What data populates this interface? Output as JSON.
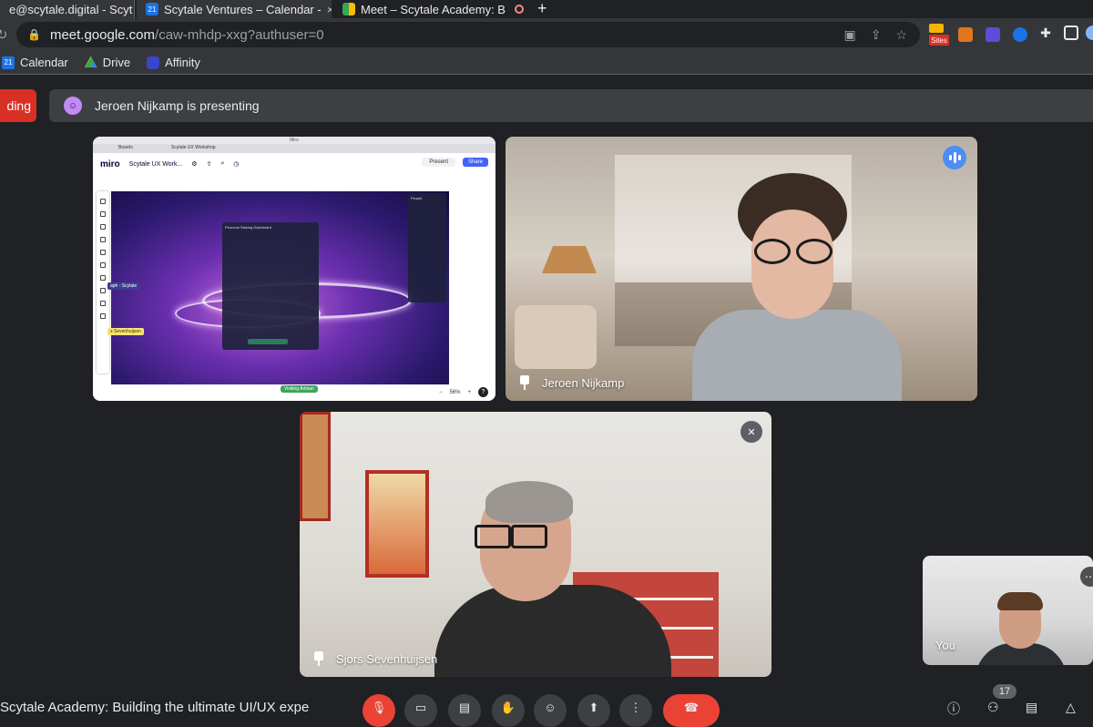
{
  "browser": {
    "tabs": [
      {
        "title": "e@scytale.digital - Scyt",
        "favicon": "gmail-icon"
      },
      {
        "title": "Scytale Ventures – Calendar - ",
        "favicon": "calendar-icon"
      },
      {
        "title": "Meet – Scytale Academy: B",
        "favicon": "meet-icon",
        "recording": true,
        "active": true
      }
    ],
    "new_tab": "+",
    "url_host": "meet.google.com",
    "url_path": "/caw-mhdp-xxg?authuser=0",
    "sites_badge": "Sites",
    "bookmarks": [
      {
        "label": "Calendar",
        "icon": "calendar-icon",
        "badge": "21"
      },
      {
        "label": "Drive",
        "icon": "drive-icon"
      },
      {
        "label": "Affinity",
        "icon": "affinity-icon"
      }
    ]
  },
  "meet": {
    "recording_label": "ding",
    "presenting_text": "Jeroen Nijkamp is presenting",
    "meeting_title": "Scytale Academy: Building the ultimate UI/UX expe",
    "participant_count": "17",
    "participants": [
      {
        "name": "Jeroen Nijkamp",
        "speaking": true
      },
      {
        "name": "Sjors Sevenhuijsen",
        "muted": true
      },
      {
        "name": "You"
      }
    ]
  },
  "miro": {
    "window_title": "Miro",
    "tabs": [
      "Boards",
      "Scytale UX Workshop"
    ],
    "logo": "miro",
    "board_name": "Scytale UX Work...",
    "present_label": "Present",
    "share_label": "Share",
    "zoom": "56%",
    "visiting_label": "Visiting Artisan",
    "panel_title": "Personal Staking Dashboard",
    "people_title": "People",
    "cursor_tags": [
      "aph - Scytale",
      "s Sevenhuijsen"
    ],
    "help": "?"
  },
  "colors": {
    "meet_bg": "#202124",
    "recording_red": "#d93025",
    "speaking_blue": "#4c8df6",
    "end_call_red": "#ea4335"
  }
}
